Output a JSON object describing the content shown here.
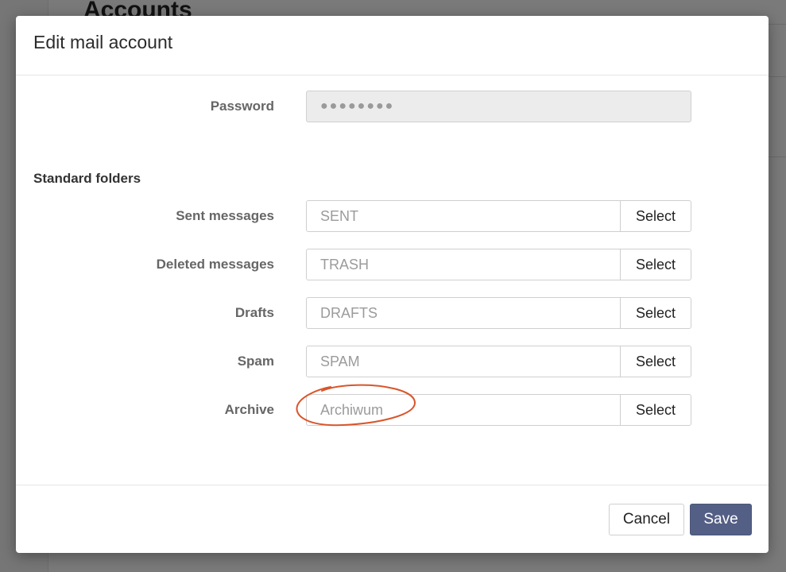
{
  "background": {
    "page_title": "Accounts"
  },
  "modal": {
    "title": "Edit mail account"
  },
  "password": {
    "label": "Password",
    "value": "●●●●●●●●"
  },
  "standard_folders": {
    "heading": "Standard folders",
    "select_label": "Select",
    "rows": [
      {
        "label": "Sent messages",
        "placeholder": "SENT"
      },
      {
        "label": "Deleted messages",
        "placeholder": "TRASH"
      },
      {
        "label": "Drafts",
        "placeholder": "DRAFTS"
      },
      {
        "label": "Spam",
        "placeholder": "SPAM"
      },
      {
        "label": "Archive",
        "placeholder": "Archiwum"
      }
    ]
  },
  "footer": {
    "cancel_label": "Cancel",
    "save_label": "Save"
  },
  "colors": {
    "primary_button": "#545f86",
    "annotation": "#d9552b"
  }
}
